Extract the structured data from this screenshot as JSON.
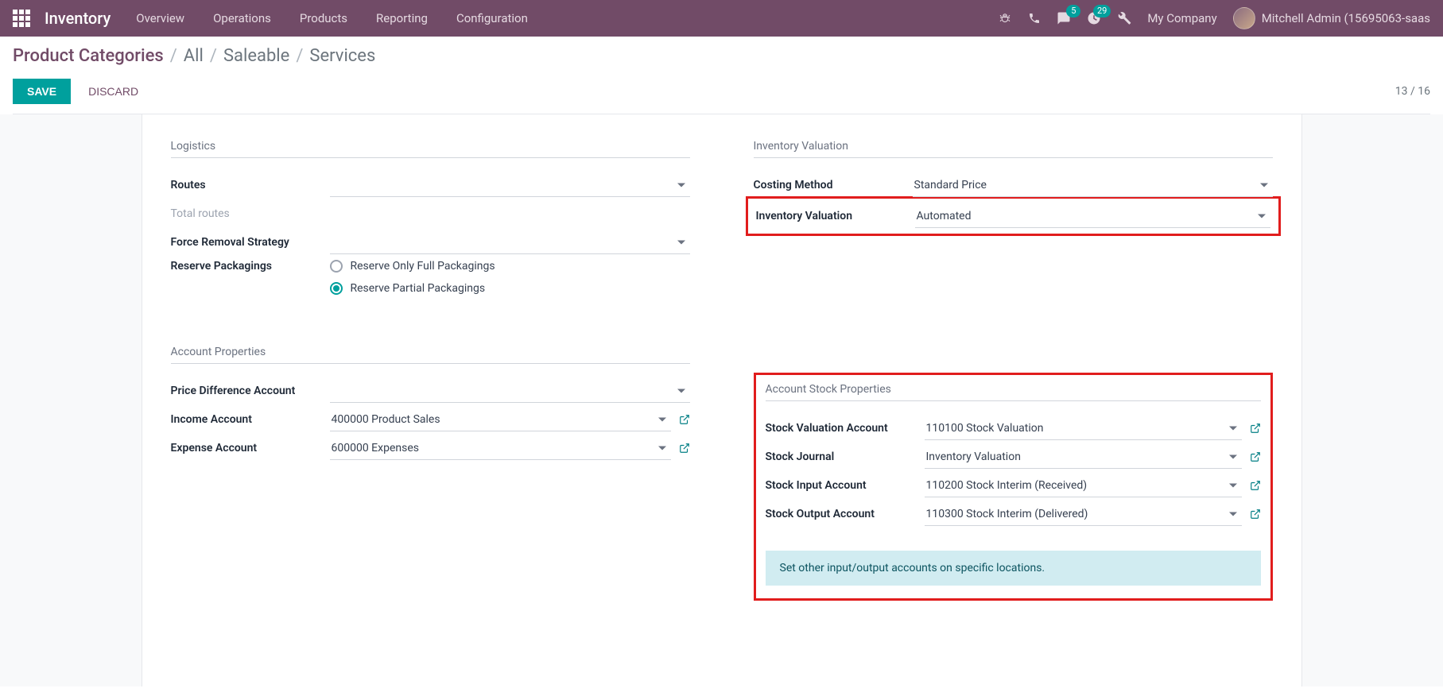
{
  "navbar": {
    "app_title": "Inventory",
    "menu": [
      "Overview",
      "Operations",
      "Products",
      "Reporting",
      "Configuration"
    ],
    "company": "My Company",
    "user": "Mitchell Admin (15695063-saas",
    "messages_badge": "5",
    "activities_badge": "29"
  },
  "breadcrumb": {
    "root": "Product Categories",
    "path": [
      "All",
      "Saleable",
      "Services"
    ]
  },
  "actions": {
    "save": "SAVE",
    "discard": "DISCARD",
    "pager": "13 / 16"
  },
  "sections": {
    "logistics": {
      "title": "Logistics",
      "routes_label": "Routes",
      "total_routes_label": "Total routes",
      "force_removal_label": "Force Removal Strategy",
      "reserve_packagings_label": "Reserve Packagings",
      "radio_full": "Reserve Only Full Packagings",
      "radio_partial": "Reserve Partial Packagings"
    },
    "inventory_valuation": {
      "title": "Inventory Valuation",
      "costing_method_label": "Costing Method",
      "costing_method_value": "Standard Price",
      "inventory_valuation_label": "Inventory Valuation",
      "inventory_valuation_value": "Automated"
    },
    "account_properties": {
      "title": "Account Properties",
      "price_diff_label": "Price Difference Account",
      "income_label": "Income Account",
      "income_value": "400000 Product Sales",
      "expense_label": "Expense Account",
      "expense_value": "600000 Expenses"
    },
    "account_stock": {
      "title": "Account Stock Properties",
      "valuation_label": "Stock Valuation Account",
      "valuation_value": "110100 Stock Valuation",
      "journal_label": "Stock Journal",
      "journal_value": "Inventory Valuation",
      "input_label": "Stock Input Account",
      "input_value": "110200 Stock Interim (Received)",
      "output_label": "Stock Output Account",
      "output_value": "110300 Stock Interim (Delivered)",
      "info_text": "Set other input/output accounts on specific locations."
    }
  }
}
